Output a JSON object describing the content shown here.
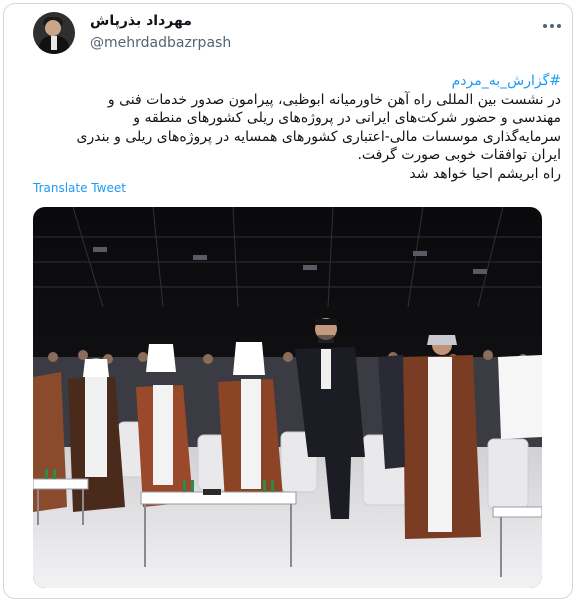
{
  "tweet": {
    "author": {
      "display_name": "مهرداد بذرپاش",
      "handle": "@mehrdadbazrpash",
      "avatar_icon": "profile-photo"
    },
    "more_icon": "more-options-icon",
    "hashtag": "#گزارش_به_مردم",
    "lines": [
      "در نشست بین المللی راه آهن خاورمیانه ابوظبی، پیرامون صدور خدمات فنی و",
      "مهندسی و حضور شرکت‌های ایرانی در پروژه‌های ریلی کشورهای منطقه و",
      "سرمایه‌گذاری موسسات مالی-اعتباری کشورهای همسایه در پروژه‌های ریلی و بندری",
      "ایران توافقات خوبی صورت گرفت.",
      "راه ابریشم احیا خواهد شد"
    ],
    "translate_label": "Translate Tweet",
    "photo": {
      "subject": "conference-attendees-standing"
    }
  },
  "colors": {
    "link": "#1d9bf0",
    "text": "#0f1419",
    "secondary": "#536471",
    "border": "#cfd9de"
  }
}
